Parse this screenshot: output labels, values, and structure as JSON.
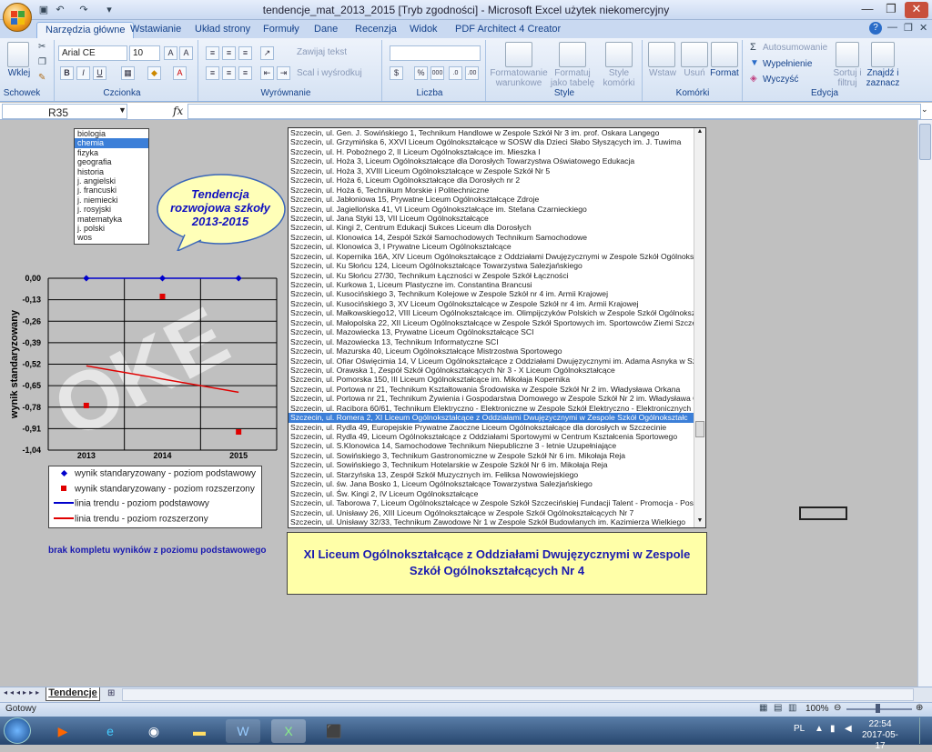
{
  "window": {
    "title": "tendencje_mat_2013_2015 [Tryb zgodności] - Microsoft Excel użytek niekomercyjny"
  },
  "tabs": [
    "Narzędzia główne",
    "Wstawianie",
    "Układ strony",
    "Formuły",
    "Dane",
    "Recenzja",
    "Widok",
    "PDF Architect 4 Creator"
  ],
  "ribbon": {
    "clipboard": {
      "paste": "Wklej",
      "group": "Schowek"
    },
    "font": {
      "name": "Arial CE",
      "size": "10",
      "group": "Czcionka"
    },
    "alignment": {
      "wrap": "Zawijaj tekst",
      "merge": "Scal i wyśrodkuj",
      "group": "Wyrównanie"
    },
    "number": {
      "group": "Liczba"
    },
    "styles": {
      "cond": "Formatowanie warunkowe",
      "table": "Formatuj jako tabelę",
      "cell": "Style komórki",
      "group": "Style"
    },
    "cells": {
      "insert": "Wstaw",
      "delete": "Usuń",
      "format": "Format",
      "group": "Komórki"
    },
    "editing": {
      "autosum": "Autosumowanie",
      "fill": "Wypełnienie",
      "clear": "Wyczyść",
      "sort": "Sortuj i filtruj",
      "find": "Znajdź i zaznacz",
      "group": "Edycja"
    }
  },
  "formula_bar": {
    "name_box": "R35",
    "fx": "fx",
    "formula": ""
  },
  "subjects": {
    "items": [
      "biologia",
      "chemia",
      "fizyka",
      "geografia",
      "historia",
      "j. angielski",
      "j. francuski",
      "j. niemiecki",
      "j. rosyjski",
      "matematyka",
      "j. polski",
      "wos"
    ],
    "selected": "chemia"
  },
  "callout": {
    "text": "Tendencja rozwojowa szkoły 2013-2015"
  },
  "schools": {
    "items": [
      "Szczecin, ul. Gen. J. Sowińskiego 1, Technikum Handlowe w Zespole Szkół Nr 3 im. prof. Oskara Langego",
      "Szczecin, ul. Grzymińska 6, XXVI Liceum Ogólnokształcące w SOSW dla Dzieci Słabo Słyszących im. J. Tuwima",
      "Szczecin, ul. H. Pobożnego 2, II Liceum Ogólnokształcące im. Mieszka I",
      "Szczecin, ul. Hoża 3, Liceum Ogólnokształcące dla Dorosłych Towarzystwa Oświatowego Edukacja",
      "Szczecin, ul. Hoża 3, XVIII Liceum Ogólnokształcące w Zespole Szkół Nr 5",
      "Szczecin, ul. Hoża 6, Liceum Ogólnokształcące dla Dorosłych nr 2",
      "Szczecin, ul. Hoża 6, Technikum Morskie i Politechniczne",
      "Szczecin, ul. Jabłoniowa 15, Prywatne Liceum Ogólnokształcące Zdroje",
      "Szczecin, ul. Jagiellońska 41, VI Liceum Ogólnokształcące im. Stefana Czarnieckiego",
      "Szczecin, ul. Jana Styki 13, VII Liceum Ogólnokształcące",
      "Szczecin, ul. Kingi 2, Centrum Edukacji Sukces Liceum dla Dorosłych",
      "Szczecin, ul. Klonowica 14, Zespół Szkół Samochodowych Technikum Samochodowe",
      "Szczecin, ul. Klonowica 3, I Prywatne Liceum Ogólnokształcące",
      "Szczecin, ul. Kopernika 16A, XIV Liceum Ogólnokształcące z Oddziałami Dwujęzycznymi w Zespole Szkół Ogólnokszta",
      "Szczecin, ul. Ku Słońcu 124, Liceum Ogólnokształcące Towarzystwa Salezjańskiego",
      "Szczecin, ul. Ku Słońcu 27/30, Technikum Łączności w Zespole Szkół Łączności",
      "Szczecin, ul. Kurkowa 1, Liceum Plastyczne im. Constantina Brancusi",
      "Szczecin, ul. Kusocińskiego 3, Technikum Kolejowe w Zespole Szkół nr 4 im. Armii Krajowej",
      "Szczecin, ul. Kusocińskiego 3, XV Liceum Ogólnokształcące w Zespole Szkół nr 4 im. Armii Krajowej",
      "Szczecin, ul. Małkowskiego12, VIII Liceum Ogólnokształcące im. Olimpijczyków Polskich w Zespole Szkół Ogólnokszta",
      "Szczecin, ul. Małopolska 22, XII Liceum Ogólnokształcące w Zespole Szkół Sportowych im. Sportowców Ziemi Szczec",
      "Szczecin, ul. Mazowiecka 13, Prywatne Liceum Ogólnokształcące SCI",
      "Szczecin, ul. Mazowiecka 13, Technikum Informatyczne SCI",
      "Szczecin, ul. Mazurska 40, Liceum Ogólnokształcące Mistrzostwa Sportowego",
      "Szczecin, ul. Ofiar Oświęcimia 14, V Liceum Ogólnokształcące z Oddziałami Dwujęzycznymi im. Adama Asnyka w Szcz",
      "Szczecin, ul. Orawska 1, Zespół Szkół Ogólnokształcących Nr 3 - X Liceum Ogólnokształcące",
      "Szczecin, ul. Pomorska 150, III Liceum Ogólnokształcące im. Mikołaja Kopernika",
      "Szczecin, ul. Portowa nr 21, Technikum Kształtowania Środowiska w Zespole Szkół Nr 2 im. Władysława Orkana",
      "Szczecin, ul. Portowa nr 21, Technikum Żywienia i Gospodarstwa Domowego w Zespole Szkół Nr 2 im. Władysława O",
      "Szczecin, ul. Racibora 60/61, Technikum Elektryczno - Elektroniczne w Zespole Szkół Elektryczno - Elektronicznych",
      "Szczecin, ul. Romera 2, XI Liceum Ogólnokształcące z Oddziałami Dwujęzycznymi w Zespole Szkół Ogólnokształc",
      "Szczecin, ul. Rydla 49, Europejskie Prywatne Zaoczne Liceum Ogólnokształcące dla dorosłych w Szczecinie",
      "Szczecin, ul. Rydla 49, Liceum Ogólnokształcące z Oddziałami Sportowymi w Centrum Kształcenia Sportowego",
      "Szczecin, ul. S.Klonowica 14, Samochodowe Technikum Niepubliczne 3 - letnie Uzupełniające",
      "Szczecin, ul. Sowińskiego 3, Technikum Gastronomiczne w Zespole Szkół Nr 6 im. Mikołaja Reja",
      "Szczecin, ul. Sowińskiego 3, Technikum Hotelarskie w Zespole Szkół Nr 6 im. Mikołaja Reja",
      "Szczecin, ul. Starzyńska 13, Zespół Szkół Muzycznych im. Feliksa Nowowiejskiego",
      "Szczecin, ul. św. Jana Bosko 1, Liceum Ogólnokształcące Towarzystwa Salezjańskiego",
      "Szczecin, ul. Św. Kingi 2, IV Liceum Ogólnokształcące",
      "Szczecin, ul. Taborowa 7, Liceum Ogólnokształcące w Zespole Szkół Szczecińskiej Fundacji Talent - Promocja - Post",
      "Szczecin, ul. Unisławy 26, XIII Liceum Ogólnokształcące w Zespole Szkół Ogólnokształcących Nr 7",
      "Szczecin, ul. Unisławy 32/33, Technikum Zawodowe Nr 1 w Zespole Szkół Budowlanych im. Kazimierza Wielkiego"
    ],
    "selected_index": 30
  },
  "result": {
    "text": "XI Liceum Ogólnokształcące z Oddziałami Dwujęzycznymi w Zespole Szkół Ogólnokształcących Nr 4"
  },
  "note": {
    "text": "brak kompletu wyników z poziomu podstawowego"
  },
  "chart_data": {
    "type": "line",
    "x": [
      "2013",
      "2014",
      "2015"
    ],
    "ylabel": "wynik standaryzowany",
    "ylim": [
      -1.04,
      0.0
    ],
    "yticks": [
      "0,00",
      "-0,13",
      "-0,26",
      "-0,39",
      "-0,52",
      "-0,65",
      "-0,78",
      "-0,91",
      "-1,04"
    ],
    "ytick_values": [
      0,
      -0.13,
      -0.26,
      -0.39,
      -0.52,
      -0.65,
      -0.78,
      -0.91,
      -1.04
    ],
    "series": [
      {
        "name": "wynik standaryzowany - poziom podstawowy",
        "kind": "points",
        "marker": "diamond",
        "color": "#0000cc",
        "values": [
          0.0,
          0.0,
          0.0
        ]
      },
      {
        "name": "wynik standaryzowany - poziom rozszerzony",
        "kind": "points",
        "marker": "square",
        "color": "#e00000",
        "values": [
          -0.77,
          -0.11,
          -0.93
        ]
      },
      {
        "name": "linia trendu - poziom podstawowy",
        "kind": "line",
        "color": "#0000cc",
        "values": [
          0.0,
          0.0,
          0.0
        ]
      },
      {
        "name": "linia trendu - poziom rozszerzony",
        "kind": "line",
        "color": "#e00000",
        "values": [
          -0.53,
          -0.61,
          -0.69
        ]
      }
    ],
    "grid": true,
    "legend": "bottom"
  },
  "sheet_tab": "Tendencje",
  "status": {
    "ready": "Gotowy",
    "zoom": "100%"
  },
  "taskbar": {
    "lang": "PL",
    "time": "22:54",
    "date": "2017-05-17"
  }
}
